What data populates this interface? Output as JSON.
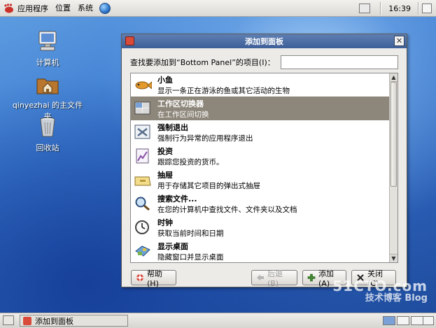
{
  "top_panel": {
    "menus": [
      "应用程序",
      "位置",
      "系统"
    ],
    "clock": "16:39"
  },
  "desktop_icons": [
    {
      "label": "计算机",
      "icon": "computer-icon"
    },
    {
      "label": "qinyezhai 的主文件夹",
      "icon": "home-folder-icon"
    },
    {
      "label": "回收站",
      "icon": "trash-icon"
    }
  ],
  "dialog": {
    "title": "添加到面板",
    "search_label": "查找要添加到“Bottom Panel”的项目(I)：",
    "search_value": "",
    "items": [
      {
        "name": "小鱼",
        "desc": "显示一条正在游泳的鱼或其它活动的生物",
        "icon": "fish-icon"
      },
      {
        "name": "工作区切换器",
        "desc": "在工作区间切换",
        "icon": "workspace-switcher-icon",
        "selected": true
      },
      {
        "name": "强制退出",
        "desc": "强制行为异常的应用程序退出",
        "icon": "force-quit-icon"
      },
      {
        "name": "投资",
        "desc": "跟踪您投资的货币。",
        "icon": "invest-chart-icon"
      },
      {
        "name": "抽屉",
        "desc": "用于存储其它项目的弹出式抽屉",
        "icon": "drawer-icon"
      },
      {
        "name": "搜索文件...",
        "desc": "在您的计算机中查找文件、文件夹以及文档",
        "icon": "search-icon"
      },
      {
        "name": "时钟",
        "desc": "获取当前时间和日期",
        "icon": "clock-icon"
      },
      {
        "name": "显示桌面",
        "desc": "隐藏窗口并显示桌面",
        "icon": "show-desktop-icon"
      }
    ],
    "buttons": {
      "help": "帮助(H)",
      "back": "后退(B)",
      "add": "添加(A)",
      "close": "关闭(C)"
    }
  },
  "bottom_panel": {
    "task_label": "添加到面板"
  },
  "watermark": {
    "line1": "51CTO.com",
    "line2": "技术博客 Blog"
  }
}
